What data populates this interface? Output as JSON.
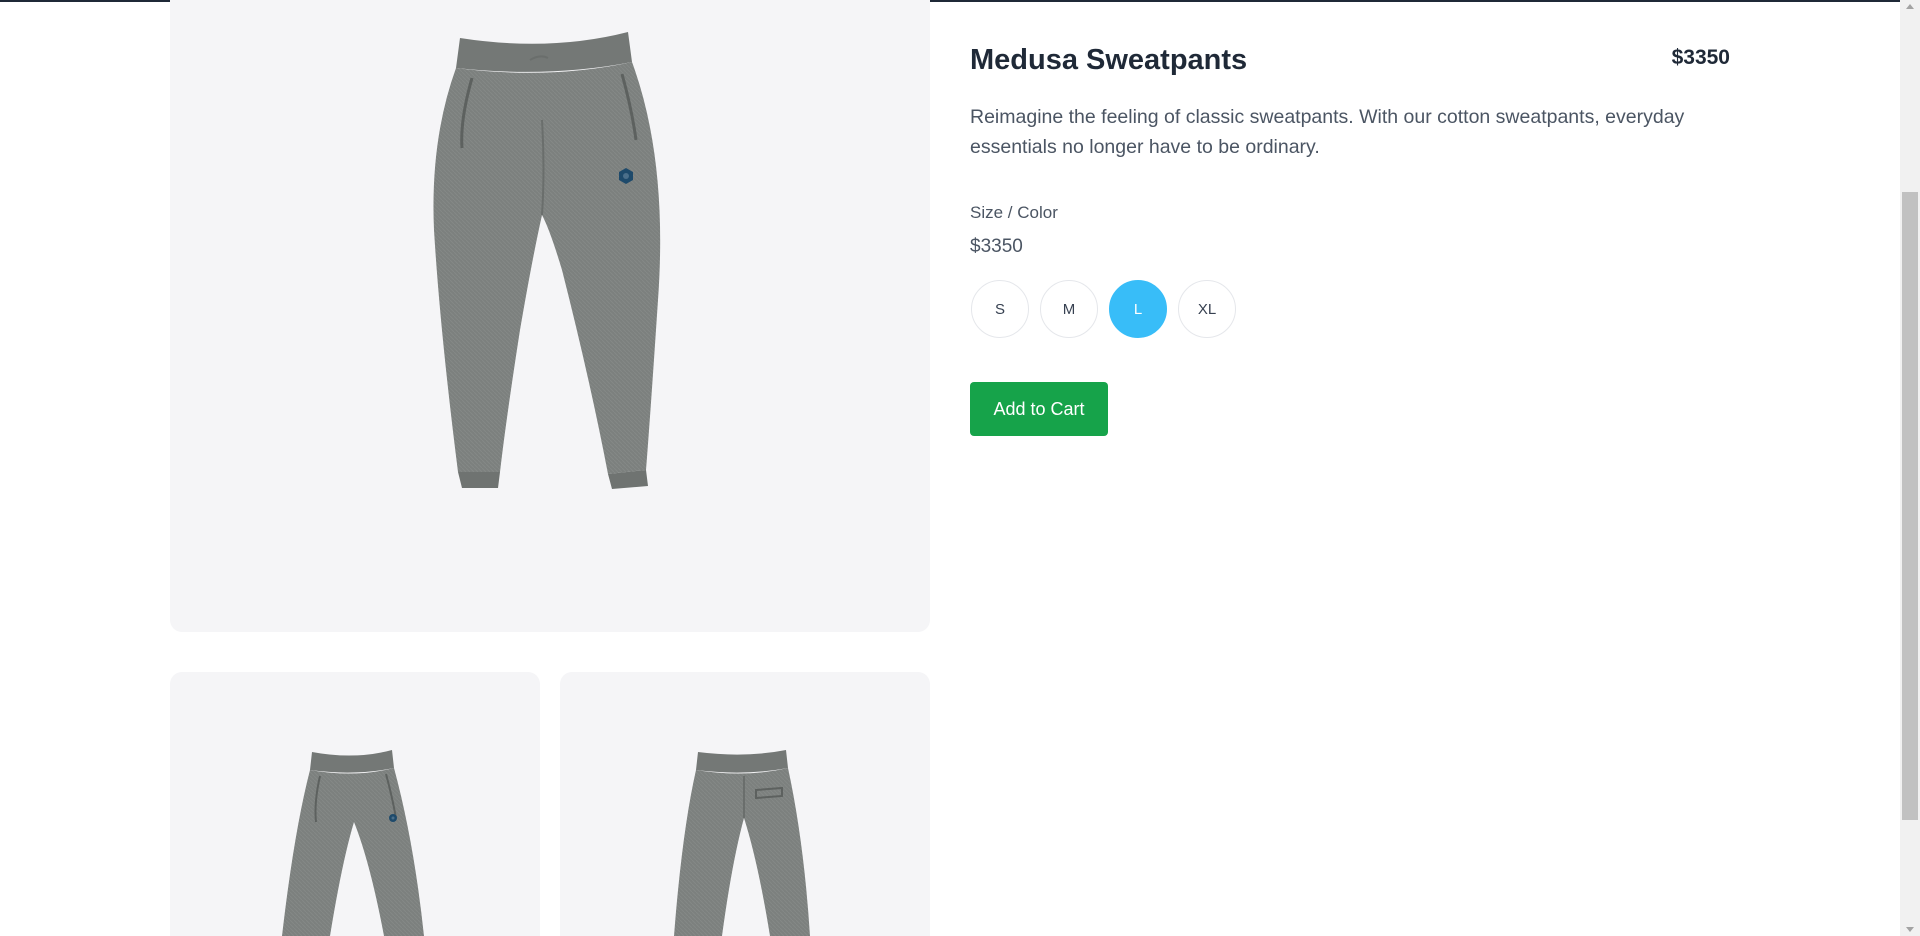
{
  "product": {
    "title": "Medusa Sweatpants",
    "price": "$3350",
    "description": "Reimagine the feeling of classic sweatpants. With our cotton sweatpants, everyday essentials no longer have to be ordinary."
  },
  "options": {
    "label": "Size / Color",
    "price": "$3350",
    "sizes": [
      {
        "label": "S",
        "selected": false
      },
      {
        "label": "M",
        "selected": false
      },
      {
        "label": "L",
        "selected": true
      },
      {
        "label": "XL",
        "selected": false
      }
    ]
  },
  "actions": {
    "add_to_cart": "Add to Cart"
  },
  "colors": {
    "accent_selected": "#38bdf8",
    "cart_button": "#16a34a",
    "image_bg": "#f5f5f7",
    "product_gray": "#7c807e",
    "logo": "#1e4a6b"
  },
  "images": [
    {
      "icon": "sweatpants-front-image"
    },
    {
      "icon": "sweatpants-front-thumbnail"
    },
    {
      "icon": "sweatpants-back-thumbnail"
    }
  ]
}
